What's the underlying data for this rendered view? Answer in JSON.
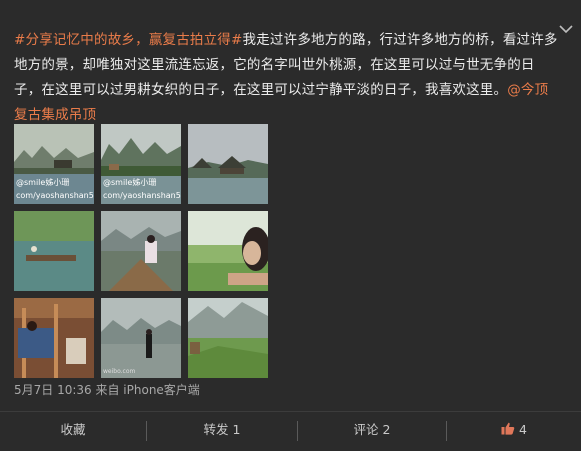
{
  "post": {
    "topic1": "#分享记忆中的故乡，",
    "topic2": "赢复古拍立得#",
    "line1_rest": "我走过许多地方的路，行过许多地方的桥，看过许多",
    "line2": "地方的景，却唯独对这里流连忘返，它的名字叫世外桃源，在这里可以过与世无争的日",
    "line3_text": "子，在这里可以过男耕女织的日子，在这里可以过宁静平淡的日子，我喜欢这里。",
    "mention_part1": "@今顶",
    "mention_part2": "复古集成吊顶",
    "watermark1_weibo": "@smile姊小珊",
    "watermark1_url": "com/yaoshanshan5",
    "watermark2_weibo": "@smile姊小珊",
    "watermark2_url": "com/yaoshanshan5",
    "meta": "5月7日 10:36 来自 iPhone客户端"
  },
  "actions": {
    "collect": "收藏",
    "repost": "转发 1",
    "comment": "评论 2",
    "like_count": "4"
  },
  "colors": {
    "background": "#2b2b2b",
    "link": "#ea7c4a",
    "text": "#ececec",
    "meta": "#a8a8a8"
  },
  "icons": {
    "collapse": "chevron-down-icon",
    "like": "thumbs-up-icon"
  }
}
